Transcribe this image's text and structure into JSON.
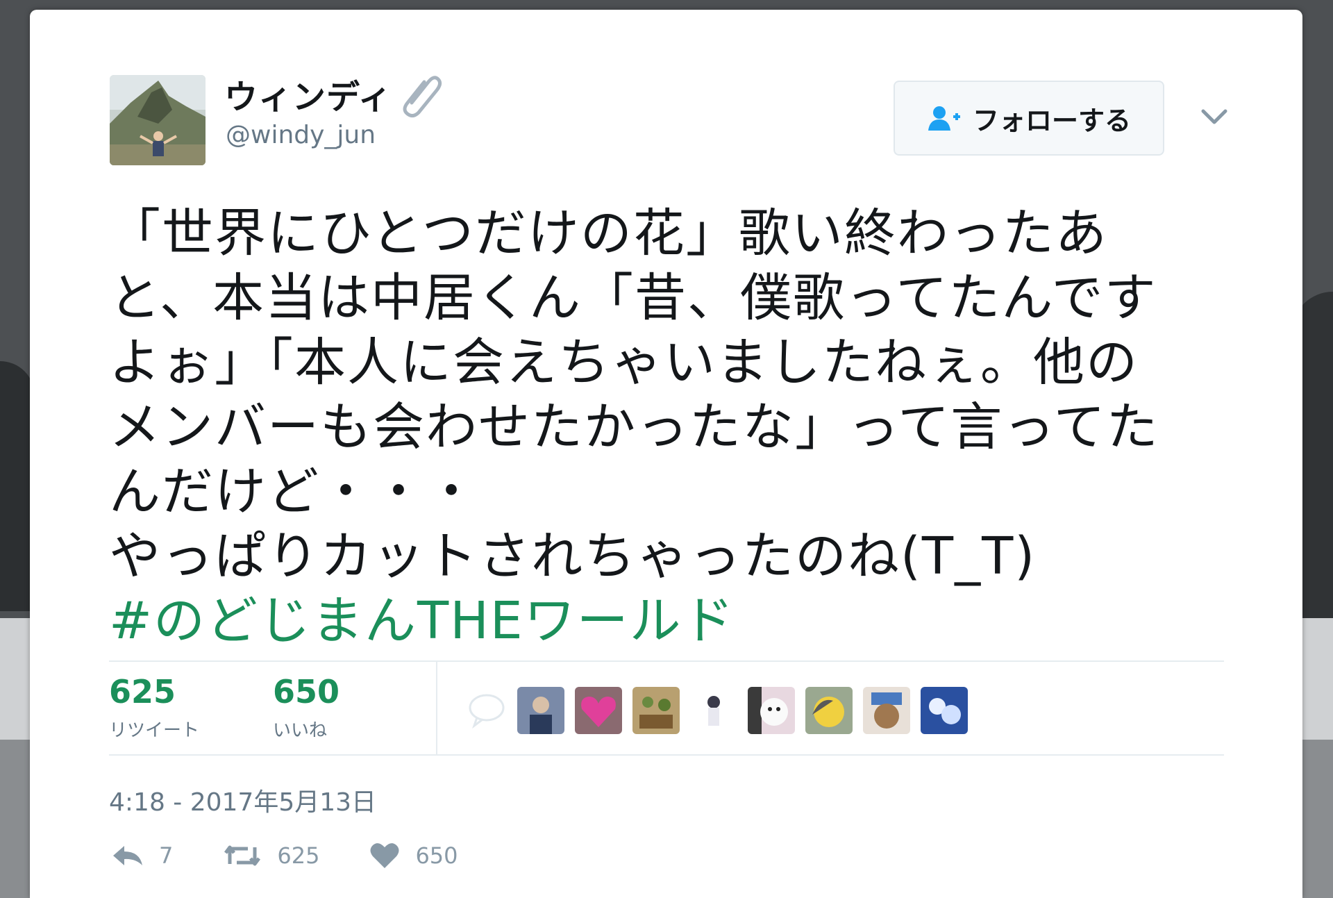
{
  "user": {
    "display_name": "ウィンディ",
    "handle": "@windy_jun"
  },
  "follow_button": {
    "label": "フォローする"
  },
  "tweet": {
    "lines": [
      "「世界にひとつだけの花」歌い終わったあ",
      "と、本当は中居くん「昔、僕歌ってたんです",
      "よぉ」「本人に会えちゃいましたねぇ。他の",
      "メンバーも会わせたかったな」って言ってた",
      "んだけど・・・",
      "やっぱりカットされちゃったのね(T_T)"
    ],
    "hashtag": "#のどじまんTHEワールド"
  },
  "stats": {
    "retweets": {
      "count": "625",
      "label": "リツイート"
    },
    "likes": {
      "count": "650",
      "label": "いいね"
    }
  },
  "timestamp": "4:18 - 2017年5月13日",
  "actions": {
    "reply_count": "7",
    "retweet_count": "625",
    "like_count": "650"
  },
  "colors": {
    "accent_green": "#1b8f5a",
    "text_primary": "#14171a",
    "text_secondary": "#657786",
    "icon_gray": "#8899a6"
  }
}
